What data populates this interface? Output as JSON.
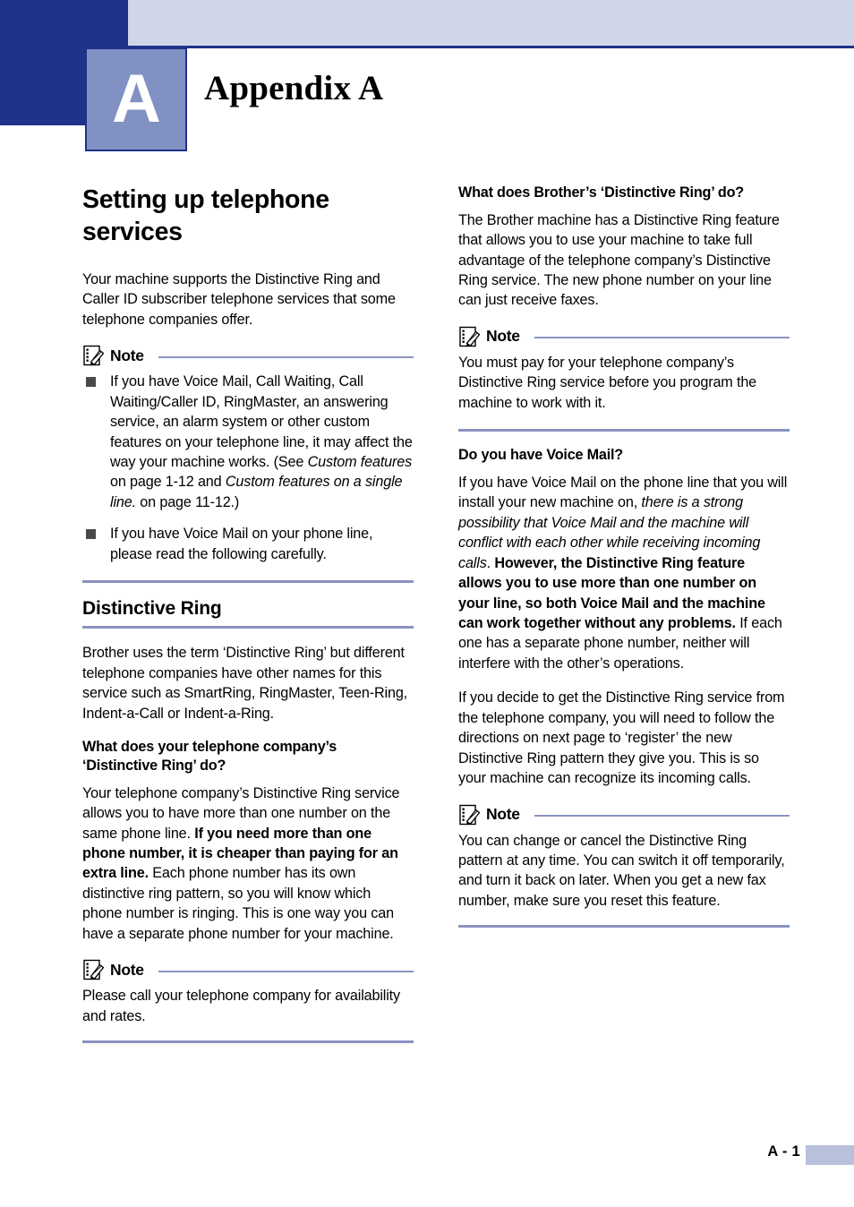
{
  "header": {
    "chapter_letter": "A",
    "chapter_title": "Appendix A",
    "colors": {
      "dark_blue": "#1f3189",
      "light_band": "#d0d5e8",
      "chapter_box": "#8291c4",
      "rule": "#8a93c2",
      "footer_block": "#b9c0db"
    }
  },
  "footer": {
    "page_number": "A - 1"
  },
  "note_label": "Note",
  "left_column": {
    "page_title": "Setting up telephone services",
    "intro_paragraph": "Your machine supports the Distinctive Ring and Caller ID subscriber telephone services that some telephone companies offer.",
    "note_1": {
      "label": "Note",
      "bullets": [
        {
          "part1": "If you have Voice Mail, Call Waiting, Call Waiting/Caller ID, RingMaster, an answering service, an alarm system or other custom features on your telephone line, it may affect the way your machine works. (See ",
          "italic1": "Custom features",
          "part2": " on page 1-12 and ",
          "italic2": "Custom features on a single line.",
          "part3": " on page 11-12.)"
        },
        {
          "text": "If you have Voice Mail on your phone line, please read the following carefully."
        }
      ]
    },
    "section_heading": "Distinctive Ring",
    "section_paragraph": "Brother uses the term ‘Distinctive Ring’ but different telephone companies have other names for this service such as SmartRing, RingMaster, Teen-Ring, Indent-a-Call or Indent-a-Ring.",
    "sub_heading": "What does your telephone company’s ‘Distinctive Ring’ do?",
    "sub_paragraph": {
      "part1": "Your telephone company’s Distinctive Ring service allows you to have more than one number on the same phone line. ",
      "bold1": "If you need more than one phone number, it is cheaper than paying for an extra line.",
      "part2": " Each phone number has its own distinctive ring pattern, so you will know which phone number is ringing. This is one way you can have a separate phone number for your machine."
    },
    "note_2": {
      "label": "Note",
      "text": "Please call your telephone company for availability and rates."
    }
  },
  "right_column": {
    "heading_1": "What does Brother’s ‘Distinctive Ring’ do?",
    "paragraph_1": "The Brother machine has a Distinctive Ring feature that allows you to use your machine to take full advantage of the telephone company’s Distinctive Ring service. The new phone number on your line can just receive faxes.",
    "note_1": {
      "label": "Note",
      "text": "You must pay for your telephone company’s Distinctive Ring service before you program the machine to work with it."
    },
    "heading_2": "Do you have Voice Mail?",
    "paragraph_2": {
      "part1": "If you have Voice Mail on the phone line that you will install your new machine on, ",
      "italic1": "there is a strong possibility that Voice Mail and the machine will conflict with each other while receiving incoming calls",
      "part2": ". ",
      "bold1": "However, the Distinctive Ring feature allows you to use more than one number on your line, so both Voice Mail and the machine can work together without any problems.",
      "part3": " If each one has a separate phone number, neither will interfere with the other’s operations."
    },
    "paragraph_3": "If you decide to get the Distinctive Ring service from the telephone company, you will need to follow the directions on next page to ‘register’ the new Distinctive Ring pattern they give you. This is so your machine can recognize its incoming calls.",
    "note_2": {
      "label": "Note",
      "text": "You can change or cancel the Distinctive Ring pattern at any time. You can switch it off temporarily, and turn it back on later. When you get a new fax number, make sure you reset this feature."
    }
  },
  "icons": {
    "note": "note-pencil-icon"
  }
}
